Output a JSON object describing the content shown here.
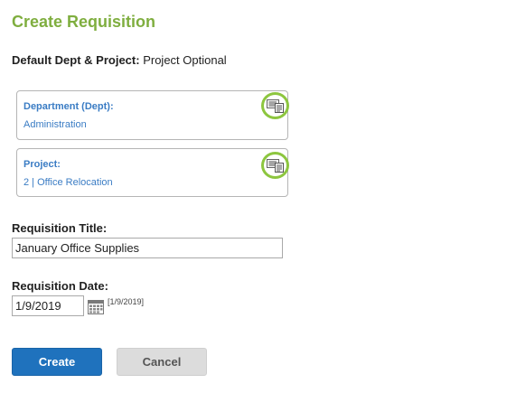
{
  "page": {
    "title": "Create Requisition"
  },
  "default": {
    "label": "Default Dept & Project:",
    "value": "Project Optional"
  },
  "department": {
    "label": "Department (Dept):",
    "value": "Administration",
    "lookup_icon": "lookup-list-icon"
  },
  "project": {
    "label": "Project:",
    "value": "2 | Office Relocation",
    "lookup_icon": "lookup-list-icon"
  },
  "requisition_title": {
    "label": "Requisition Title:",
    "value": "January Office Supplies"
  },
  "requisition_date": {
    "label": "Requisition Date:",
    "value": "1/9/2019",
    "hint": "[1/9/2019]",
    "icon": "calendar-icon"
  },
  "buttons": {
    "create": "Create",
    "cancel": "Cancel"
  },
  "colors": {
    "title": "#7fae3f",
    "link": "#3a7cc4",
    "highlight": "#8dc63f",
    "primary": "#1f72bd",
    "secondary": "#dcdcdc"
  }
}
